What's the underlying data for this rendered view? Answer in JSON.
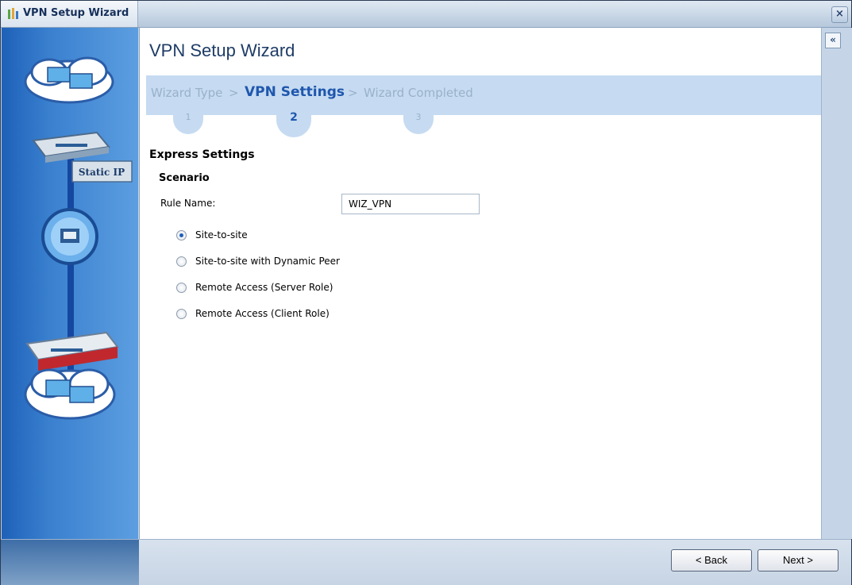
{
  "window": {
    "title": "VPN Setup Wizard",
    "close_label": "×"
  },
  "sidebar": {
    "connection_type_label": "Static IP"
  },
  "page": {
    "title": "VPN Setup Wizard",
    "collapse_label": "«"
  },
  "steps": [
    {
      "label": "Wizard Type",
      "number": "1"
    },
    {
      "label": "VPN Settings",
      "number": "2"
    },
    {
      "label": "Wizard Completed",
      "number": "3"
    }
  ],
  "steps_separator": ">",
  "form": {
    "section_title": "Express Settings",
    "scenario_title": "Scenario",
    "rule_name_label": "Rule Name:",
    "rule_name_value": "WIZ_VPN",
    "scenario_options": [
      {
        "label": "Site-to-site",
        "selected": true
      },
      {
        "label": "Site-to-site with Dynamic Peer",
        "selected": false
      },
      {
        "label": "Remote Access (Server Role)",
        "selected": false
      },
      {
        "label": "Remote Access (Client Role)",
        "selected": false
      }
    ]
  },
  "footer": {
    "back_label": "< Back",
    "next_label": "Next >"
  },
  "colors": {
    "accent": "#1f57ae",
    "sidebar": "#2f74c9",
    "band": "#c6dbf1"
  },
  "icons": [
    "wizard-app-icon",
    "close-icon",
    "collapse-icon",
    "cloud-network-icon",
    "router-icon",
    "ethernet-port-icon",
    "firewall-device-icon"
  ]
}
